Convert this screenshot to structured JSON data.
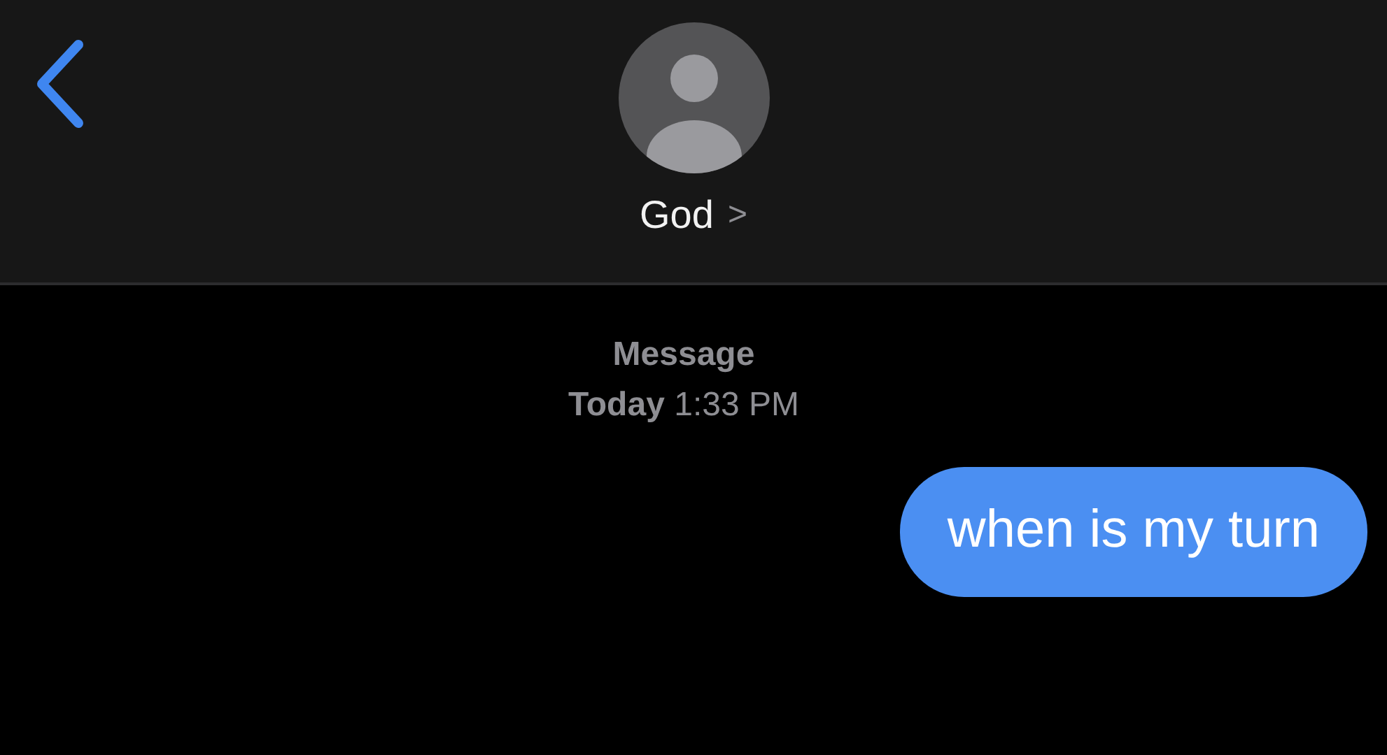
{
  "header": {
    "contact": "God",
    "chevron": ">"
  },
  "thread": {
    "service": "Message",
    "timestamp": "**Today** 1:33 PM"
  },
  "messages": [
    {
      "text": "when is my turn",
      "kind": "outgoing"
    }
  ]
}
